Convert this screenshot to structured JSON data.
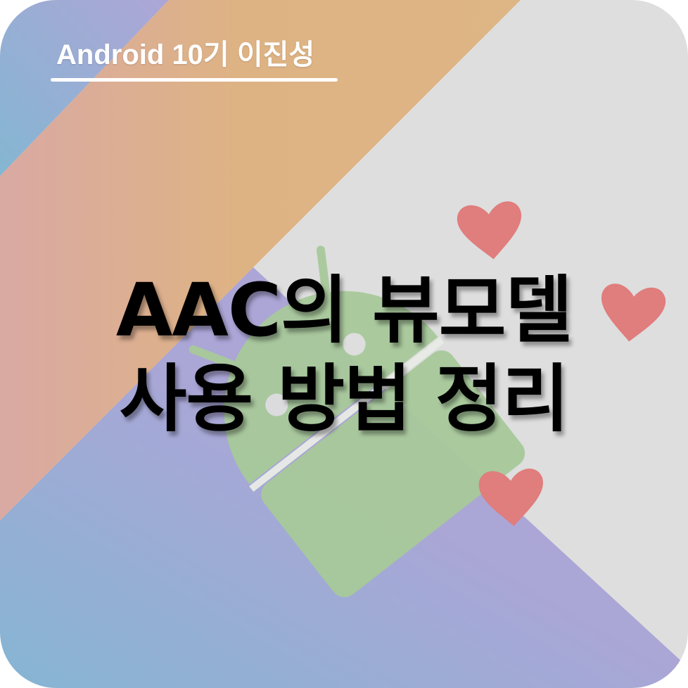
{
  "tag": {
    "text": "Android 10기 이진성"
  },
  "title": {
    "line1": "AAC의 뷰모델",
    "line2": "사용 방법 정리"
  },
  "colors": {
    "background": "#dedede",
    "orange": "#deb584",
    "purple": "#ada6d6",
    "blue": "#84b6d2",
    "pink": "#d6a6a6",
    "android_green": "#a8c99b",
    "heart": "#e07d7d",
    "title_text": "#000000",
    "tag_text": "#ffffff"
  },
  "decorations": {
    "mascot": "android-robot-icon",
    "hearts": [
      "heart-icon",
      "heart-icon",
      "heart-icon"
    ]
  }
}
